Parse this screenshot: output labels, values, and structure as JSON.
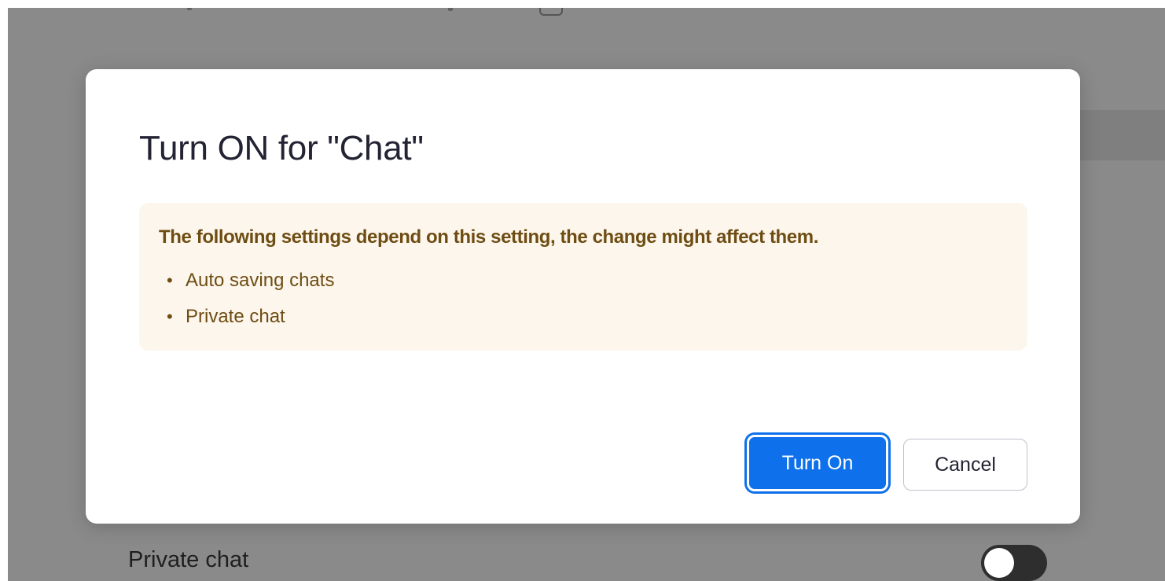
{
  "background": {
    "private_chat_label": "Private chat",
    "private_chat_toggle": {
      "state": "off"
    }
  },
  "dialog": {
    "title": "Turn ON for \"Chat\"",
    "warning": {
      "heading": "The following settings depend on this setting, the change might affect them.",
      "items": [
        {
          "label": "Auto saving chats"
        },
        {
          "label": "Private chat"
        }
      ]
    },
    "buttons": {
      "confirm_label": "Turn On",
      "cancel_label": "Cancel"
    }
  },
  "colors": {
    "primary": "#0e71eb",
    "warning_bg": "#fdf6ec",
    "warning_text": "#6e4d13",
    "overlay": "#8a8a8a"
  }
}
